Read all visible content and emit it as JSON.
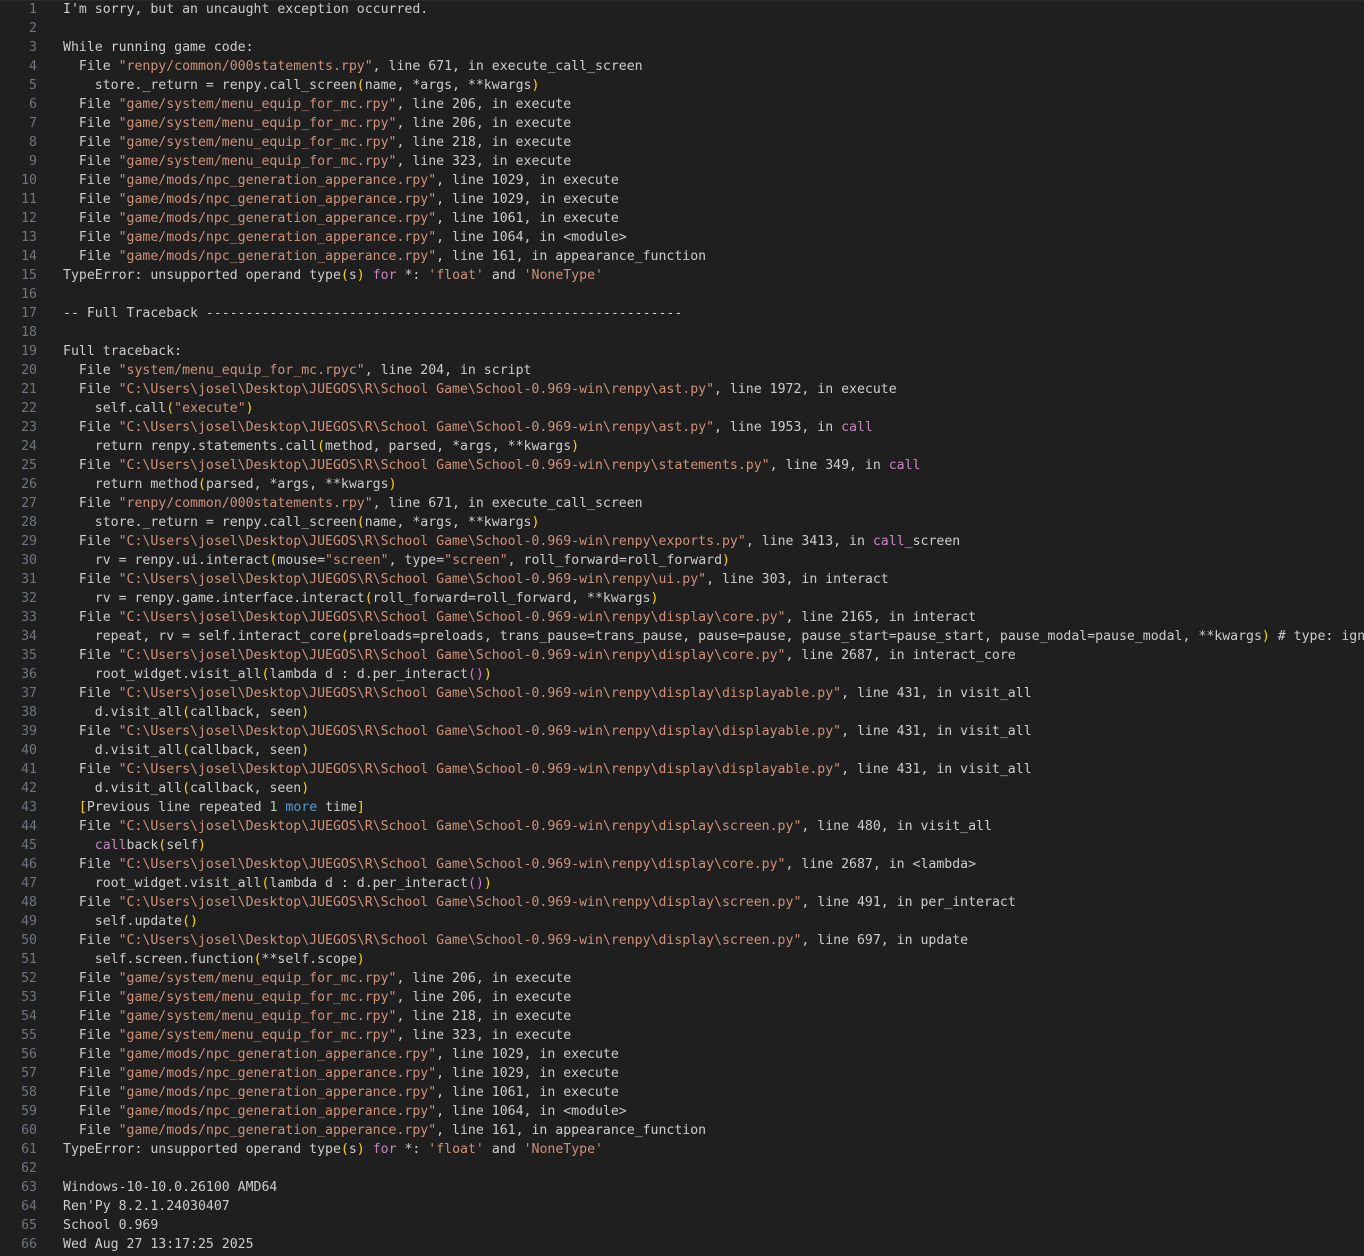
{
  "lines": [
    [
      {
        "t": "I'm sorry, but an uncaught exception occurred."
      }
    ],
    [],
    [
      {
        "t": "While running game code:"
      }
    ],
    [
      {
        "t": "  File "
      },
      {
        "t": "\"renpy/common/000statements.rpy\"",
        "c": "s"
      },
      {
        "t": ", line 671, in execute_call_screen"
      }
    ],
    [
      {
        "t": "    store._return = renpy.call_screen"
      },
      {
        "t": "(",
        "c": "p"
      },
      {
        "t": "name, *args, **kwargs"
      },
      {
        "t": ")",
        "c": "p"
      }
    ],
    [
      {
        "t": "  File "
      },
      {
        "t": "\"game/system/menu_equip_for_mc.rpy\"",
        "c": "s"
      },
      {
        "t": ", line 206, in execute"
      }
    ],
    [
      {
        "t": "  File "
      },
      {
        "t": "\"game/system/menu_equip_for_mc.rpy\"",
        "c": "s"
      },
      {
        "t": ", line 206, in execute"
      }
    ],
    [
      {
        "t": "  File "
      },
      {
        "t": "\"game/system/menu_equip_for_mc.rpy\"",
        "c": "s"
      },
      {
        "t": ", line 218, in execute"
      }
    ],
    [
      {
        "t": "  File "
      },
      {
        "t": "\"game/system/menu_equip_for_mc.rpy\"",
        "c": "s"
      },
      {
        "t": ", line 323, in execute"
      }
    ],
    [
      {
        "t": "  File "
      },
      {
        "t": "\"game/mods/npc_generation_apperance.rpy\"",
        "c": "s"
      },
      {
        "t": ", line 1029, in execute"
      }
    ],
    [
      {
        "t": "  File "
      },
      {
        "t": "\"game/mods/npc_generation_apperance.rpy\"",
        "c": "s"
      },
      {
        "t": ", line 1029, in execute"
      }
    ],
    [
      {
        "t": "  File "
      },
      {
        "t": "\"game/mods/npc_generation_apperance.rpy\"",
        "c": "s"
      },
      {
        "t": ", line 1061, in execute"
      }
    ],
    [
      {
        "t": "  File "
      },
      {
        "t": "\"game/mods/npc_generation_apperance.rpy\"",
        "c": "s"
      },
      {
        "t": ", line 1064, in <module>"
      }
    ],
    [
      {
        "t": "  File "
      },
      {
        "t": "\"game/mods/npc_generation_apperance.rpy\"",
        "c": "s"
      },
      {
        "t": ", line 161, in appearance_function"
      }
    ],
    [
      {
        "t": "TypeError: unsupported operand type"
      },
      {
        "t": "(",
        "c": "p"
      },
      {
        "t": "s"
      },
      {
        "t": ")",
        "c": "p"
      },
      {
        "t": " "
      },
      {
        "t": "for",
        "c": "c"
      },
      {
        "t": " *: "
      },
      {
        "t": "'float'",
        "c": "s"
      },
      {
        "t": " and "
      },
      {
        "t": "'NoneType'",
        "c": "s"
      }
    ],
    [],
    [
      {
        "t": "-- Full Traceback ------------------------------------------------------------"
      }
    ],
    [],
    [
      {
        "t": "Full traceback:"
      }
    ],
    [
      {
        "t": "  File "
      },
      {
        "t": "\"system/menu_equip_for_mc.rpyc\"",
        "c": "s"
      },
      {
        "t": ", line 204, in script"
      }
    ],
    [
      {
        "t": "  File "
      },
      {
        "t": "\"C:\\Users\\josel\\Desktop\\JUEGOS\\R\\School Game\\School-0.969-win\\renpy\\ast.py\"",
        "c": "s"
      },
      {
        "t": ", line 1972, in execute"
      }
    ],
    [
      {
        "t": "    self.call"
      },
      {
        "t": "(",
        "c": "p"
      },
      {
        "t": "\"execute\"",
        "c": "s"
      },
      {
        "t": ")",
        "c": "p"
      }
    ],
    [
      {
        "t": "  File "
      },
      {
        "t": "\"C:\\Users\\josel\\Desktop\\JUEGOS\\R\\School Game\\School-0.969-win\\renpy\\ast.py\"",
        "c": "s"
      },
      {
        "t": ", line 1953, in "
      },
      {
        "t": "call",
        "c": "c"
      }
    ],
    [
      {
        "t": "    return renpy.statements.call"
      },
      {
        "t": "(",
        "c": "p"
      },
      {
        "t": "method, parsed, *args, **kwargs"
      },
      {
        "t": ")",
        "c": "p"
      }
    ],
    [
      {
        "t": "  File "
      },
      {
        "t": "\"C:\\Users\\josel\\Desktop\\JUEGOS\\R\\School Game\\School-0.969-win\\renpy\\statements.py\"",
        "c": "s"
      },
      {
        "t": ", line 349, in "
      },
      {
        "t": "call",
        "c": "c"
      }
    ],
    [
      {
        "t": "    return method"
      },
      {
        "t": "(",
        "c": "p"
      },
      {
        "t": "parsed, *args, **kwargs"
      },
      {
        "t": ")",
        "c": "p"
      }
    ],
    [
      {
        "t": "  File "
      },
      {
        "t": "\"renpy/common/000statements.rpy\"",
        "c": "s"
      },
      {
        "t": ", line 671, in execute_call_screen"
      }
    ],
    [
      {
        "t": "    store._return = renpy.call_screen"
      },
      {
        "t": "(",
        "c": "p"
      },
      {
        "t": "name, *args, **kwargs"
      },
      {
        "t": ")",
        "c": "p"
      }
    ],
    [
      {
        "t": "  File "
      },
      {
        "t": "\"C:\\Users\\josel\\Desktop\\JUEGOS\\R\\School Game\\School-0.969-win\\renpy\\exports.py\"",
        "c": "s"
      },
      {
        "t": ", line 3413, in "
      },
      {
        "t": "call",
        "c": "c"
      },
      {
        "t": "_screen"
      }
    ],
    [
      {
        "t": "    rv = renpy.ui.interact"
      },
      {
        "t": "(",
        "c": "p"
      },
      {
        "t": "mouse="
      },
      {
        "t": "\"screen\"",
        "c": "s"
      },
      {
        "t": ", type="
      },
      {
        "t": "\"screen\"",
        "c": "s"
      },
      {
        "t": ", roll_forward=roll_forward"
      },
      {
        "t": ")",
        "c": "p"
      }
    ],
    [
      {
        "t": "  File "
      },
      {
        "t": "\"C:\\Users\\josel\\Desktop\\JUEGOS\\R\\School Game\\School-0.969-win\\renpy\\ui.py\"",
        "c": "s"
      },
      {
        "t": ", line 303, in interact"
      }
    ],
    [
      {
        "t": "    rv = renpy.game.interface.interact"
      },
      {
        "t": "(",
        "c": "p"
      },
      {
        "t": "roll_forward=roll_forward, **kwargs"
      },
      {
        "t": ")",
        "c": "p"
      }
    ],
    [
      {
        "t": "  File "
      },
      {
        "t": "\"C:\\Users\\josel\\Desktop\\JUEGOS\\R\\School Game\\School-0.969-win\\renpy\\display\\core.py\"",
        "c": "s"
      },
      {
        "t": ", line 2165, in interact"
      }
    ],
    [
      {
        "t": "    repeat, rv = self.interact_core"
      },
      {
        "t": "(",
        "c": "p"
      },
      {
        "t": "preloads=preloads, trans_pause=trans_pause, pause=pause, pause_start=pause_start, pause_modal=pause_modal, **kwargs"
      },
      {
        "t": ")",
        "c": "p"
      },
      {
        "t": " # type: ignore"
      }
    ],
    [
      {
        "t": "  File "
      },
      {
        "t": "\"C:\\Users\\josel\\Desktop\\JUEGOS\\R\\School Game\\School-0.969-win\\renpy\\display\\core.py\"",
        "c": "s"
      },
      {
        "t": ", line 2687, in interact_core"
      }
    ],
    [
      {
        "t": "    root_widget.visit_all"
      },
      {
        "t": "(",
        "c": "p"
      },
      {
        "t": "lambda d : d.per_interact"
      },
      {
        "t": "(",
        "c": "q"
      },
      {
        "t": ")",
        "c": "q"
      },
      {
        "t": ")",
        "c": "p"
      }
    ],
    [
      {
        "t": "  File "
      },
      {
        "t": "\"C:\\Users\\josel\\Desktop\\JUEGOS\\R\\School Game\\School-0.969-win\\renpy\\display\\displayable.py\"",
        "c": "s"
      },
      {
        "t": ", line 431, in visit_all"
      }
    ],
    [
      {
        "t": "    d.visit_all"
      },
      {
        "t": "(",
        "c": "p"
      },
      {
        "t": "callback, seen"
      },
      {
        "t": ")",
        "c": "p"
      }
    ],
    [
      {
        "t": "  File "
      },
      {
        "t": "\"C:\\Users\\josel\\Desktop\\JUEGOS\\R\\School Game\\School-0.969-win\\renpy\\display\\displayable.py\"",
        "c": "s"
      },
      {
        "t": ", line 431, in visit_all"
      }
    ],
    [
      {
        "t": "    d.visit_all"
      },
      {
        "t": "(",
        "c": "p"
      },
      {
        "t": "callback, seen"
      },
      {
        "t": ")",
        "c": "p"
      }
    ],
    [
      {
        "t": "  File "
      },
      {
        "t": "\"C:\\Users\\josel\\Desktop\\JUEGOS\\R\\School Game\\School-0.969-win\\renpy\\display\\displayable.py\"",
        "c": "s"
      },
      {
        "t": ", line 431, in visit_all"
      }
    ],
    [
      {
        "t": "    d.visit_all"
      },
      {
        "t": "(",
        "c": "p"
      },
      {
        "t": "callback, seen"
      },
      {
        "t": ")",
        "c": "p"
      }
    ],
    [
      {
        "t": "  "
      },
      {
        "t": "[",
        "c": "p"
      },
      {
        "t": "Previous line repeated "
      },
      {
        "t": "1",
        "c": "n"
      },
      {
        "t": " "
      },
      {
        "t": "more",
        "c": "k"
      },
      {
        "t": " time"
      },
      {
        "t": "]",
        "c": "p"
      }
    ],
    [
      {
        "t": "  File "
      },
      {
        "t": "\"C:\\Users\\josel\\Desktop\\JUEGOS\\R\\School Game\\School-0.969-win\\renpy\\display\\screen.py\"",
        "c": "s"
      },
      {
        "t": ", line 480, in visit_all"
      }
    ],
    [
      {
        "t": "    "
      },
      {
        "t": "call",
        "c": "c"
      },
      {
        "t": "back"
      },
      {
        "t": "(",
        "c": "p"
      },
      {
        "t": "self"
      },
      {
        "t": ")",
        "c": "p"
      }
    ],
    [
      {
        "t": "  File "
      },
      {
        "t": "\"C:\\Users\\josel\\Desktop\\JUEGOS\\R\\School Game\\School-0.969-win\\renpy\\display\\core.py\"",
        "c": "s"
      },
      {
        "t": ", line 2687, in <lambda>"
      }
    ],
    [
      {
        "t": "    root_widget.visit_all"
      },
      {
        "t": "(",
        "c": "p"
      },
      {
        "t": "lambda d : d.per_interact"
      },
      {
        "t": "(",
        "c": "q"
      },
      {
        "t": ")",
        "c": "q"
      },
      {
        "t": ")",
        "c": "p"
      }
    ],
    [
      {
        "t": "  File "
      },
      {
        "t": "\"C:\\Users\\josel\\Desktop\\JUEGOS\\R\\School Game\\School-0.969-win\\renpy\\display\\screen.py\"",
        "c": "s"
      },
      {
        "t": ", line 491, in per_interact"
      }
    ],
    [
      {
        "t": "    self.update"
      },
      {
        "t": "(",
        "c": "p"
      },
      {
        "t": ")",
        "c": "p"
      }
    ],
    [
      {
        "t": "  File "
      },
      {
        "t": "\"C:\\Users\\josel\\Desktop\\JUEGOS\\R\\School Game\\School-0.969-win\\renpy\\display\\screen.py\"",
        "c": "s"
      },
      {
        "t": ", line 697, in update"
      }
    ],
    [
      {
        "t": "    self.screen.function"
      },
      {
        "t": "(",
        "c": "p"
      },
      {
        "t": "**self.scope"
      },
      {
        "t": ")",
        "c": "p"
      }
    ],
    [
      {
        "t": "  File "
      },
      {
        "t": "\"game/system/menu_equip_for_mc.rpy\"",
        "c": "s"
      },
      {
        "t": ", line 206, in execute"
      }
    ],
    [
      {
        "t": "  File "
      },
      {
        "t": "\"game/system/menu_equip_for_mc.rpy\"",
        "c": "s"
      },
      {
        "t": ", line 206, in execute"
      }
    ],
    [
      {
        "t": "  File "
      },
      {
        "t": "\"game/system/menu_equip_for_mc.rpy\"",
        "c": "s"
      },
      {
        "t": ", line 218, in execute"
      }
    ],
    [
      {
        "t": "  File "
      },
      {
        "t": "\"game/system/menu_equip_for_mc.rpy\"",
        "c": "s"
      },
      {
        "t": ", line 323, in execute"
      }
    ],
    [
      {
        "t": "  File "
      },
      {
        "t": "\"game/mods/npc_generation_apperance.rpy\"",
        "c": "s"
      },
      {
        "t": ", line 1029, in execute"
      }
    ],
    [
      {
        "t": "  File "
      },
      {
        "t": "\"game/mods/npc_generation_apperance.rpy\"",
        "c": "s"
      },
      {
        "t": ", line 1029, in execute"
      }
    ],
    [
      {
        "t": "  File "
      },
      {
        "t": "\"game/mods/npc_generation_apperance.rpy\"",
        "c": "s"
      },
      {
        "t": ", line 1061, in execute"
      }
    ],
    [
      {
        "t": "  File "
      },
      {
        "t": "\"game/mods/npc_generation_apperance.rpy\"",
        "c": "s"
      },
      {
        "t": ", line 1064, in <module>"
      }
    ],
    [
      {
        "t": "  File "
      },
      {
        "t": "\"game/mods/npc_generation_apperance.rpy\"",
        "c": "s"
      },
      {
        "t": ", line 161, in appearance_function"
      }
    ],
    [
      {
        "t": "TypeError: unsupported operand type"
      },
      {
        "t": "(",
        "c": "p"
      },
      {
        "t": "s"
      },
      {
        "t": ")",
        "c": "p"
      },
      {
        "t": " "
      },
      {
        "t": "for",
        "c": "c"
      },
      {
        "t": " *: "
      },
      {
        "t": "'float'",
        "c": "s"
      },
      {
        "t": " and "
      },
      {
        "t": "'NoneType'",
        "c": "s"
      }
    ],
    [],
    [
      {
        "t": "Windows-10-10.0.26100 AMD64"
      }
    ],
    [
      {
        "t": "Ren'Py 8.2.1.24030407"
      }
    ],
    [
      {
        "t": "School 0.969"
      }
    ],
    [
      {
        "t": "Wed Aug 27 13:17:25 2025"
      }
    ]
  ]
}
